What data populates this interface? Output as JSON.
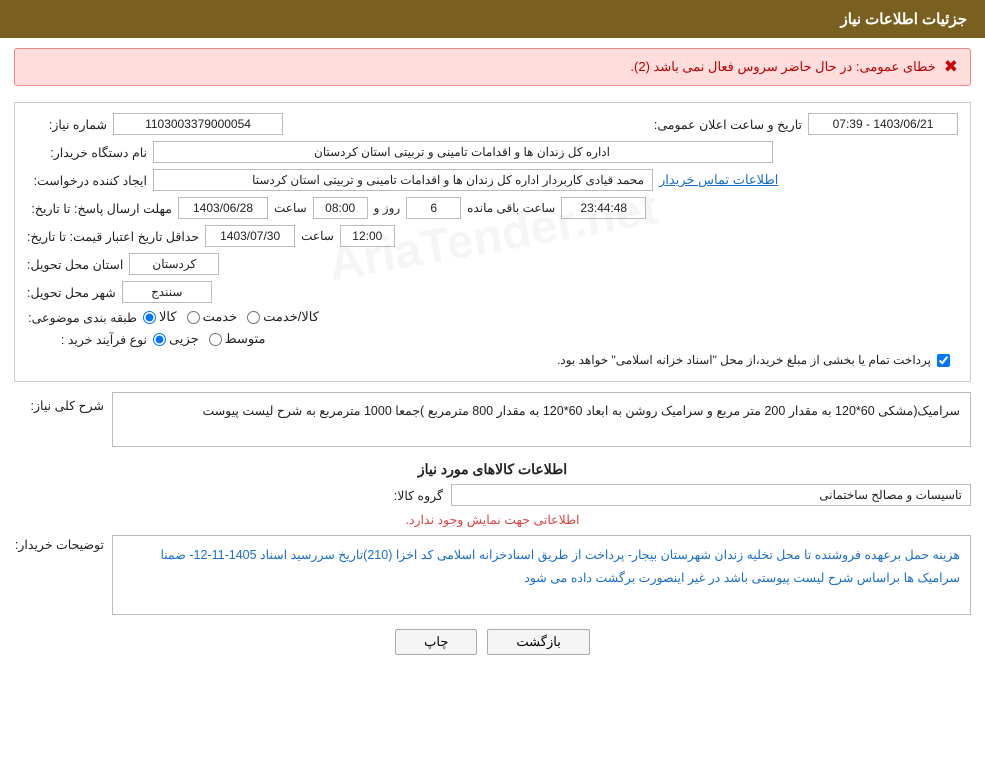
{
  "header": {
    "title": "جزئیات اطلاعات نیاز"
  },
  "error": {
    "icon": "✖",
    "message": "خطای عمومی: در حال حاضر سروس فعال نمی باشد (2)."
  },
  "fields": {
    "shomareNiaz_label": "شماره نیاز:",
    "shomareNiaz_value": "1103003379000054",
    "namDastgah_label": "نام دستگاه خریدار:",
    "namDastgah_value": "اداره کل زندان ها و اقدامات تامینی و تربیتی استان کردستان",
    "tajabKarbar_label": "ایجاد کننده درخواست:",
    "tajabKarbar_value": "محمد  قیادی کاربردار اداره کل زندان ها و اقدامات تامینی و تربیتی استان کردستا",
    "tajabKarbar_link": "اطلاعات تماس خریدار",
    "tarikhElan_label": "تاریخ و ساعت اعلان عمومی:",
    "tarikhElan_value": "1403/06/21 - 07:39",
    "mohlat_label": "مهلت ارسال پاسخ: تا تاریخ:",
    "mohlat_date": "1403/06/28",
    "mohlat_time": "08:00",
    "mohlat_days": "6",
    "mohlat_remaining": "23:44:48",
    "mohlat_remaining_label": "ساعت باقی مانده",
    "mohlat_rozo": "روز و",
    "hadaqal_label": "حداقل تاریخ اعتبار قیمت: تا تاریخ:",
    "hadaqal_date": "1403/07/30",
    "hadaqal_time": "12:00",
    "ostan_label": "استان محل تحویل:",
    "ostan_value": "کردستان",
    "shahr_label": "شهر محل تحویل:",
    "shahr_value": "سنندج",
    "tabaqe_label": "طبقه بندی موضوعی:",
    "tabaqe_kala": "کالا",
    "tabaqe_khedmat": "خدمت",
    "tabaqe_kala_khedmat": "کالا/خدمت",
    "tabaqe_selected": "kala",
    "noeFarayand_label": "نوع فرآیند خرید :",
    "noeFarayand_jozii": "جزیی",
    "noeFarayand_motavasset": "متوسط",
    "noeFarayand_selected": "jozii",
    "pardakht_label": "پرداخت تمام یا بخشی از مبلغ خرید،از محل \"اسناد خزانه اسلامی\" خواهد بود.",
    "pardakht_checked": true,
    "sharh_label": "شرح کلی نیاز:",
    "sharh_value": "سرامیک(مشکی  60*120  به مقدار 200 متر مربع  و  سرامیک روشن به ابعاد 60*120 به مقدار 800 مترمربع\n)جمعا 1000 مترمربع به شرح لیست پیوست",
    "kalaInfo_title": "اطلاعات کالاهای مورد نیاز",
    "gorohKala_label": "گروه کالا:",
    "gorohKala_value": "تاسیسات و مصالح ساختمانی",
    "noInfo": "اطلاعاتی جهت نمایش وجود ندارد.",
    "tawzihKharidad_label": "توضیحات خریدار:",
    "tawzihKharidad_value": "هزینه حمل برعهده فروشنده  تا محل  تخلیه  زندان  شهرستان بیجار- پرداخت از طریق اسنادخزانه اسلامی کد اخزا (210)تاریخ سررسید اسناد 1405-11-12- ضمنا سرامیک ها براساس شرح لیست پیوستی باشد در غیر اینصورت برگشت داده می شود"
  },
  "buttons": {
    "print": "چاپ",
    "back": "بازگشت"
  }
}
